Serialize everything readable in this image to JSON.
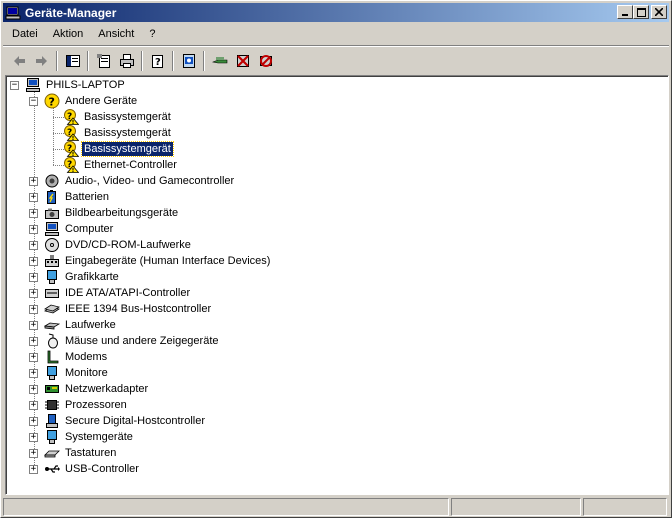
{
  "window": {
    "title": "Geräte-Manager",
    "caption_buttons": {
      "minimize": "_",
      "maximize": "□",
      "close": "×"
    }
  },
  "menubar": {
    "items": [
      {
        "label": "Datei"
      },
      {
        "label": "Aktion"
      },
      {
        "label": "Ansicht"
      },
      {
        "label": "?"
      }
    ]
  },
  "toolbar": {
    "buttons": [
      {
        "icon": "back-arrow-icon"
      },
      {
        "icon": "forward-arrow-icon"
      },
      {
        "icon": "show-hide-console-tree-icon"
      },
      {
        "icon": "properties-icon"
      },
      {
        "icon": "print-icon"
      },
      {
        "icon": "help-icon"
      },
      {
        "icon": "scan-hardware-changes-icon"
      },
      {
        "icon": "update-driver-icon"
      },
      {
        "icon": "uninstall-icon"
      },
      {
        "icon": "disable-device-icon"
      }
    ]
  },
  "tree": {
    "root": {
      "label": "PHILS-LAPTOP",
      "icon": "computer-icon"
    },
    "expanded_category": {
      "label": "Andere Geräte",
      "icon": "unknown-device-icon",
      "children": [
        {
          "label": "Basissystemgerät",
          "icon": "warning-device-icon",
          "selected": false
        },
        {
          "label": "Basissystemgerät",
          "icon": "warning-device-icon",
          "selected": false
        },
        {
          "label": "Basissystemgerät",
          "icon": "warning-device-icon",
          "selected": true
        },
        {
          "label": "Ethernet-Controller",
          "icon": "warning-device-icon",
          "selected": false
        }
      ]
    },
    "categories": [
      {
        "label": "Audio-, Video- und Gamecontroller",
        "icon": "speaker-icon"
      },
      {
        "label": "Batterien",
        "icon": "battery-icon"
      },
      {
        "label": "Bildbearbeitungsgeräte",
        "icon": "camera-icon"
      },
      {
        "label": "Computer",
        "icon": "computer-icon"
      },
      {
        "label": "DVD/CD-ROM-Laufwerke",
        "icon": "cd-drive-icon"
      },
      {
        "label": "Eingabegeräte (Human Interface Devices)",
        "icon": "hid-icon"
      },
      {
        "label": "Grafikkarte",
        "icon": "display-adapter-icon"
      },
      {
        "label": "IDE ATA/ATAPI-Controller",
        "icon": "ide-controller-icon"
      },
      {
        "label": "IEEE 1394 Bus-Hostcontroller",
        "icon": "firewire-icon"
      },
      {
        "label": "Laufwerke",
        "icon": "disk-drive-icon"
      },
      {
        "label": "Mäuse und andere Zeigegeräte",
        "icon": "mouse-icon"
      },
      {
        "label": "Modems",
        "icon": "modem-icon"
      },
      {
        "label": "Monitore",
        "icon": "monitor-icon"
      },
      {
        "label": "Netzwerkadapter",
        "icon": "network-adapter-icon"
      },
      {
        "label": "Prozessoren",
        "icon": "processor-icon"
      },
      {
        "label": "Secure Digital-Hostcontroller",
        "icon": "sd-host-icon"
      },
      {
        "label": "Systemgeräte",
        "icon": "system-device-icon"
      },
      {
        "label": "Tastaturen",
        "icon": "keyboard-icon"
      },
      {
        "label": "USB-Controller",
        "icon": "usb-icon"
      }
    ]
  },
  "statusbar": {
    "panels": [
      "",
      "",
      ""
    ]
  },
  "colors": {
    "title_gradient_start": "#0a246a",
    "title_gradient_end": "#a6caf0",
    "selection": "#0a246a",
    "chrome": "#d4d0c8"
  }
}
